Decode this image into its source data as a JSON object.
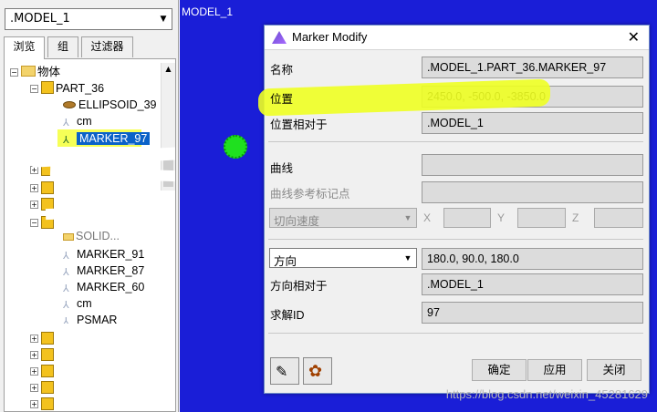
{
  "left_panel": {
    "model_selector": {
      "value": ".MODEL_1"
    },
    "tabs": [
      {
        "label": "浏览"
      },
      {
        "label": "组"
      },
      {
        "label": "过滤器"
      }
    ],
    "tree": {
      "root": "物体",
      "part": "PART_36",
      "children": [
        "ELLIPSOID_39",
        "cm",
        "MARKER_97"
      ],
      "lower_items": [
        "MARKER_91",
        "MARKER_87",
        "MARKER_60",
        "cm",
        "PSMAR"
      ],
      "partial_item": "SOLID..."
    }
  },
  "viewport": {
    "model_label": "MODEL_1"
  },
  "dialog": {
    "title": "Marker Modify",
    "rows": {
      "name": {
        "label": "名称",
        "value": ".MODEL_1.PART_36.MARKER_97"
      },
      "location": {
        "label": "位置",
        "value": "2450.0, -500.0, -3850.0"
      },
      "location_relative_to": {
        "label": "位置相对于",
        "value": ".MODEL_1"
      },
      "curve": {
        "label": "曲线",
        "value": ""
      },
      "curve_ref_marker": {
        "label": "曲线参考标记点",
        "value": ""
      },
      "tangent_mode": {
        "label": "切向速度",
        "x": "X",
        "y": "Y",
        "z": "Z"
      },
      "orientation": {
        "label": "方向",
        "value": "180.0, 90.0, 180.0"
      },
      "orientation_relative_to": {
        "label": "方向相对于",
        "value": ".MODEL_1"
      },
      "solver_id": {
        "label": "求解ID",
        "value": "97"
      }
    },
    "buttons": {
      "ok": "确定",
      "apply": "应用",
      "close": "关闭"
    }
  },
  "watermark": "https://blog.csdn.net/weixin_45281629"
}
